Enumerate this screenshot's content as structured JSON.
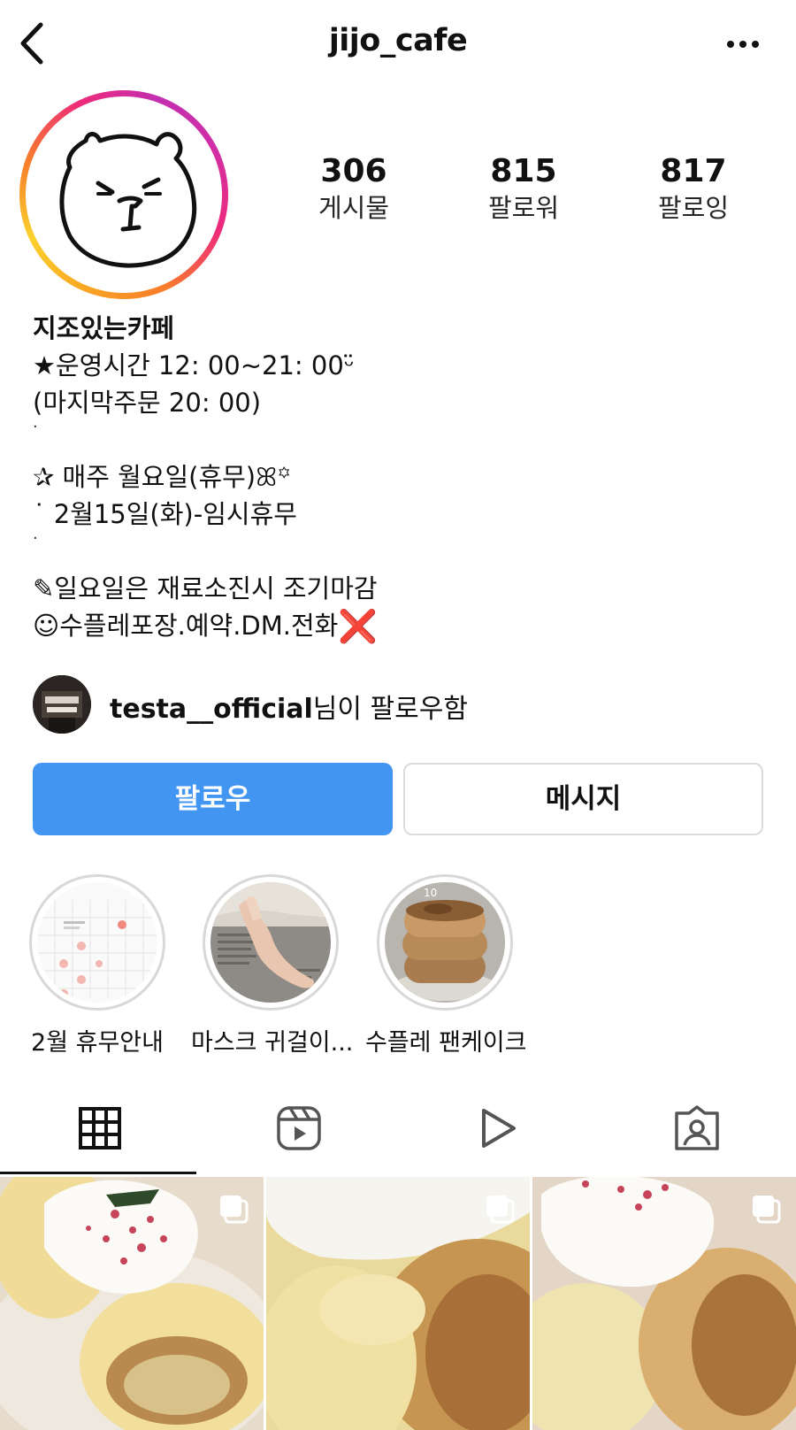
{
  "header": {
    "username": "jijo_cafe",
    "back_icon": "chevron-left-icon",
    "more_icon": "more-horizontal-icon"
  },
  "stats": [
    {
      "value": "306",
      "label": "게시물"
    },
    {
      "value": "815",
      "label": "팔로워"
    },
    {
      "value": "817",
      "label": "팔로잉"
    }
  ],
  "bio": {
    "name": "지조있는카페",
    "line1": "★운영시간 12: 00~21: 00ᵕ̈",
    "line2": "(마지막주문 20: 00)",
    "dot1": "·",
    "line3": "✰ 매주 월요일(휴무)ꕤ꙳",
    "line4": "˙ 2월15일(화)-임시휴무",
    "dot2": "·",
    "line5": "✎일요일은 재료소진시 조기마감",
    "line6": "☺︎수플레포장.예약.DM.전화",
    "line6_mark": "❌"
  },
  "followed_by": {
    "username": "testa__official",
    "suffix": "님이 팔로우함"
  },
  "buttons": {
    "follow": "팔로우",
    "message": "메시지"
  },
  "highlights": [
    {
      "label": "2월 휴무안내"
    },
    {
      "label": "마스크 귀걸이..."
    },
    {
      "label": "수플레 팬케이크"
    }
  ],
  "tabs": [
    {
      "icon": "grid-icon",
      "selected": true
    },
    {
      "icon": "reels-icon",
      "selected": false
    },
    {
      "icon": "play-icon",
      "selected": false
    },
    {
      "icon": "tagged-person-icon",
      "selected": false
    }
  ],
  "posts": [
    {
      "type": "multi-photo"
    },
    {
      "type": "multi-photo"
    },
    {
      "type": "multi-photo"
    }
  ],
  "colors": {
    "follow_button": "#4295f0",
    "text": "#111111",
    "border": "#dbdbdb"
  }
}
